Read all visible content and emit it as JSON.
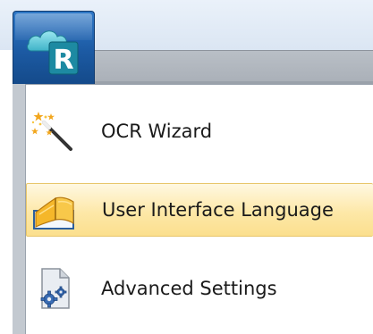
{
  "app_button": {
    "logo_letter": "R",
    "icon": "cloud-r-logo-icon"
  },
  "menu": {
    "items": [
      {
        "label": "OCR Wizard",
        "icon": "magic-wand-icon",
        "highlighted": false
      },
      {
        "label": "User Interface Language",
        "icon": "open-book-icon",
        "highlighted": true
      },
      {
        "label": "Advanced Settings",
        "icon": "settings-document-icon",
        "highlighted": false
      }
    ]
  },
  "colors": {
    "app_button": "#1c5aa3",
    "highlight": "#fde8a8",
    "highlight_border": "#e8c66a"
  }
}
